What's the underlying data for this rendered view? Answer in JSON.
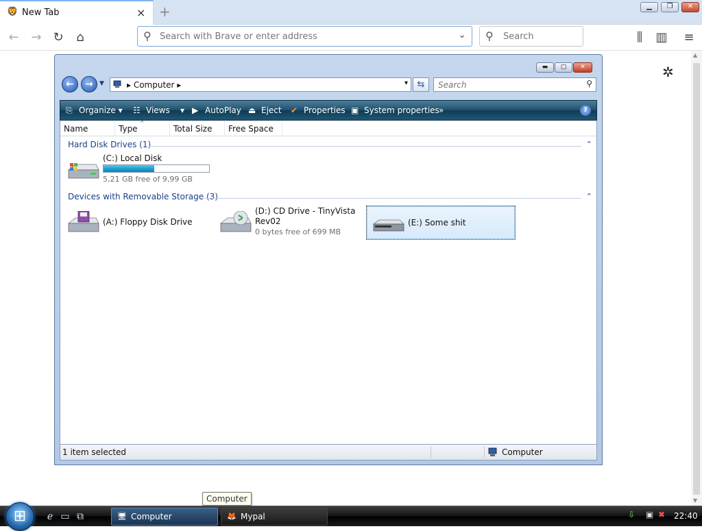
{
  "browser": {
    "tab": {
      "title": "New Tab",
      "favicon": "brave-lion-icon",
      "close": "×"
    },
    "new_tab": "+",
    "window_buttons": {
      "minimize": "▁",
      "restore": "❐",
      "close": "✕"
    },
    "nav": {
      "back": "←",
      "forward": "→",
      "reload": "↻",
      "home": "⌂"
    },
    "address": {
      "placeholder": "Search with Brave or enter address",
      "value": ""
    },
    "search": {
      "placeholder": "Search",
      "value": ""
    },
    "toolbar_icons": {
      "library": "⫼",
      "sidebar": "▥",
      "menu": "≡"
    },
    "settings_gear": "✲"
  },
  "explorer": {
    "caption_buttons": {
      "minimize": "▬",
      "maximize": "▢",
      "close": "✕"
    },
    "address": {
      "crumb": "▸  Computer  ▸",
      "dropdown": "▾"
    },
    "search_placeholder": "Search",
    "commands": [
      {
        "label": "Organize",
        "icon": "⎘",
        "has_menu": true
      },
      {
        "label": "Views",
        "icon": "☷",
        "has_menu": true
      },
      {
        "label": "AutoPlay",
        "icon": "▶"
      },
      {
        "label": "Eject",
        "icon": "⏏"
      },
      {
        "label": "Properties",
        "icon": "✔"
      },
      {
        "label": "System properties",
        "icon": "▣"
      },
      {
        "label": "»",
        "icon": ""
      }
    ],
    "help": "?",
    "columns": [
      "Name",
      "Type",
      "Total Size",
      "Free Space"
    ],
    "groups": [
      {
        "label": "Hard Disk Drives (1)",
        "items": [
          {
            "name": "(C:) Local Disk",
            "detail": "5,21 GB free of 9,99 GB",
            "used_fraction": 0.48
          }
        ]
      },
      {
        "label": "Devices with Removable Storage (3)",
        "items": [
          {
            "name": "(A:) Floppy Disk Drive",
            "detail": ""
          },
          {
            "name": "(D:) CD Drive - TinyVista Rev02",
            "detail": "0 bytes free of 699 MB"
          },
          {
            "name": "(E:) Some shit",
            "detail": "",
            "selected": true
          }
        ]
      }
    ],
    "status": {
      "left": "1 item selected",
      "right": "Computer"
    }
  },
  "tooltip": "Computer",
  "taskbar": {
    "buttons": [
      {
        "label": "Computer",
        "active": true
      },
      {
        "label": "Mypal",
        "active": false
      }
    ],
    "clock": "22:40"
  }
}
